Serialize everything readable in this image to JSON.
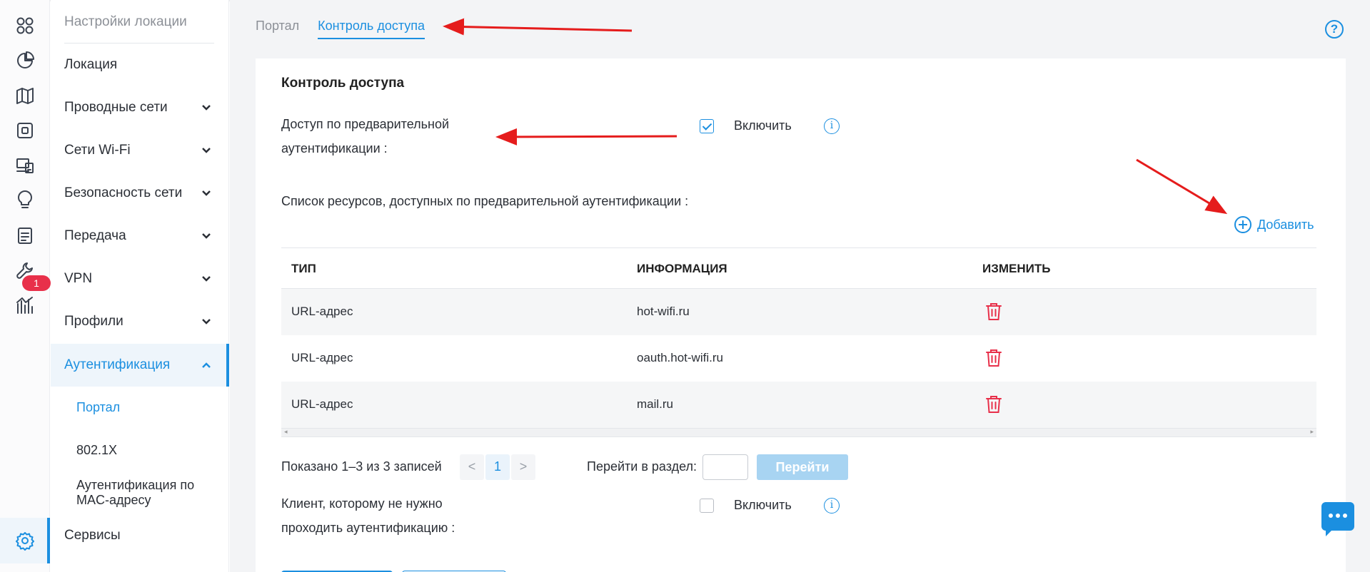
{
  "rail": {
    "items": [
      {
        "icon": "apps-grid-icon"
      },
      {
        "icon": "pie-chart-icon"
      },
      {
        "icon": "map-icon"
      },
      {
        "icon": "device-icon"
      },
      {
        "icon": "devices-icon"
      },
      {
        "icon": "lightbulb-icon"
      },
      {
        "icon": "logs-icon",
        "badge": "1"
      },
      {
        "icon": "wrench-icon"
      },
      {
        "icon": "stats-icon"
      },
      {
        "icon": "settings-gear-icon",
        "active": true
      }
    ],
    "badge": "1"
  },
  "nav": {
    "header": "Настройки локации",
    "items": [
      {
        "label": "Локация"
      },
      {
        "label": "Проводные сети"
      },
      {
        "label": "Сети Wi-Fi"
      },
      {
        "label": "Безопасность сети"
      },
      {
        "label": "Передача"
      },
      {
        "label": "VPN"
      },
      {
        "label": "Профили"
      },
      {
        "label": "Аутентификация"
      },
      {
        "label": "Сервисы"
      }
    ],
    "sub_items": [
      {
        "label": "Портал"
      },
      {
        "label": "802.1X"
      },
      {
        "label": "Аутентификация по MAC-адресу"
      }
    ]
  },
  "tabs": [
    "Портал",
    "Контроль доступа"
  ],
  "help": "?",
  "card": {
    "title": "Контроль доступа",
    "preauth_label_line1": "Доступ по предварительной",
    "preauth_label_line2": "аутентификации :",
    "preauth_toggle": "Включить",
    "resources_label": "Список ресурсов, доступных по предварительной аутентификации :",
    "add_label": "Добавить",
    "table": {
      "columns": [
        "ТИП",
        "ИНФОРМАЦИЯ",
        "ИЗМЕНИТЬ"
      ],
      "rows": [
        {
          "type": "URL-адрес",
          "info": "hot-wifi.ru"
        },
        {
          "type": "URL-адрес",
          "info": "oauth.hot-wifi.ru"
        },
        {
          "type": "URL-адрес",
          "info": "mail.ru"
        }
      ]
    },
    "pagination": {
      "summary": "Показано 1–3 из 3 записей",
      "prev": "<",
      "page": "1",
      "next": ">",
      "goto_label": "Перейти в раздел:",
      "goto_button": "Перейти"
    },
    "free_client_label_line1": "Клиент, которому не нужно",
    "free_client_label_line2": "проходить аутентификацию :",
    "free_client_toggle": "Включить"
  },
  "colors": {
    "accent": "#1b8fe0",
    "danger": "#e8304a",
    "annotation_arrow": "#e51c1c"
  }
}
